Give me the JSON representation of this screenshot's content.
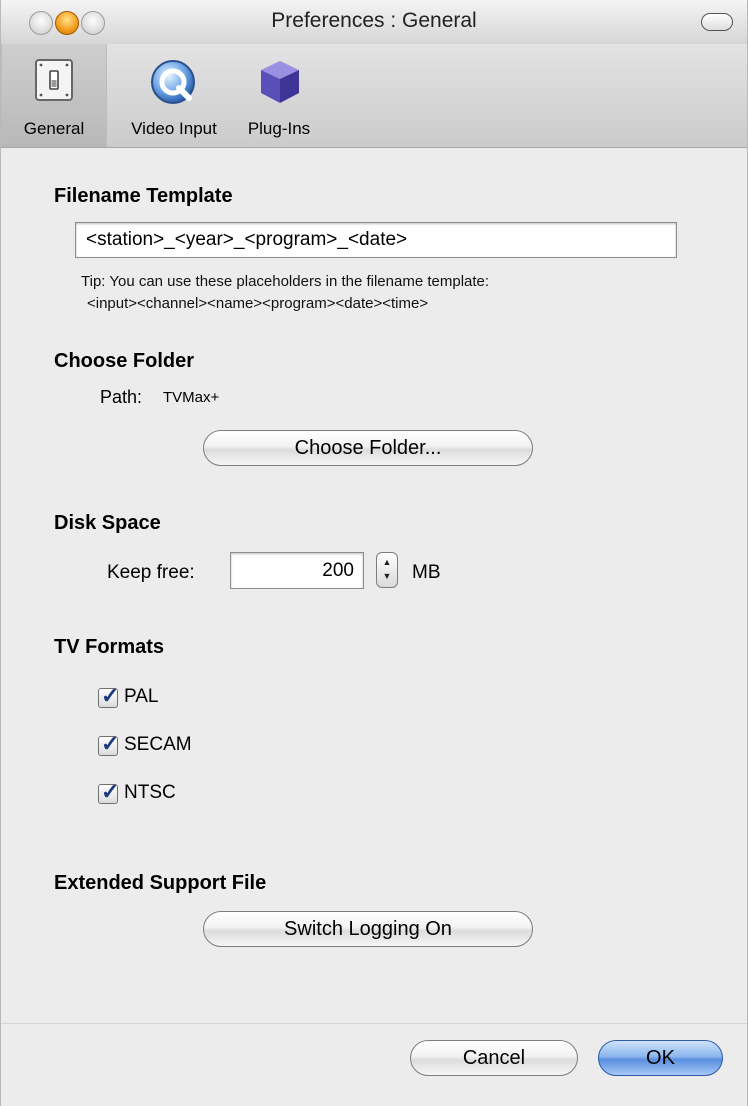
{
  "window": {
    "title": "Preferences : General"
  },
  "toolbar": {
    "items": [
      {
        "label": "General",
        "icon": "light-switch-icon",
        "selected": true
      },
      {
        "label": "Video Input",
        "icon": "quicktime-icon",
        "selected": false
      },
      {
        "label": "Plug-Ins",
        "icon": "cube-icon",
        "selected": false
      }
    ]
  },
  "filename": {
    "title": "Filename Template",
    "value": "<station>_<year>_<program>_<date>",
    "tip_line1": "Tip: You can use these placeholders in the filename template:",
    "tip_line2": "<input><channel><name><program><date><time>"
  },
  "folder": {
    "title": "Choose Folder",
    "path_label": "Path:",
    "path_value": "TVMax+",
    "button": "Choose Folder..."
  },
  "disk": {
    "title": "Disk Space",
    "keep_free_label": "Keep free:",
    "keep_free_value": "200",
    "unit": "MB"
  },
  "formats": {
    "title": "TV Formats",
    "items": [
      {
        "label": "PAL",
        "checked": true
      },
      {
        "label": "SECAM",
        "checked": true
      },
      {
        "label": "NTSC",
        "checked": true
      }
    ]
  },
  "support": {
    "title": "Extended Support File",
    "button": "Switch Logging On"
  },
  "footer": {
    "cancel": "Cancel",
    "ok": "OK"
  },
  "colors": {
    "window_bg": "#ececec",
    "default_button": "#5b8fdf",
    "check_mark": "#1d3b7a"
  }
}
